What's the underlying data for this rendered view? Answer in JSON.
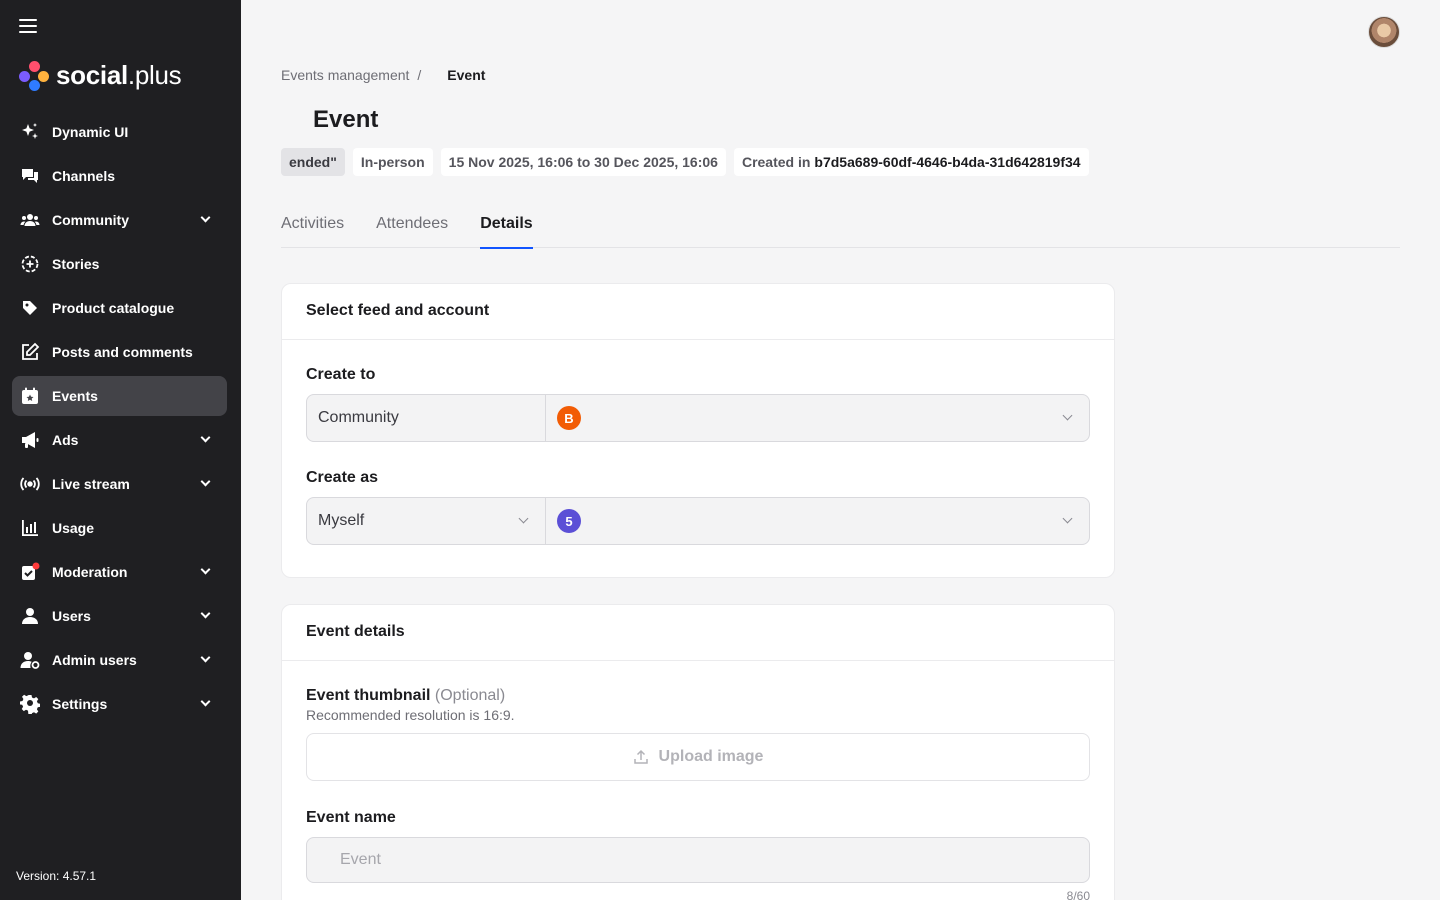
{
  "brand": {
    "name_bold": "social",
    "name_light": ".plus"
  },
  "sidebar": {
    "items": [
      {
        "label": "Dynamic UI",
        "icon": "sparkles-icon",
        "expandable": false,
        "active": false
      },
      {
        "label": "Channels",
        "icon": "chat-bubbles-icon",
        "expandable": false,
        "active": false
      },
      {
        "label": "Community",
        "icon": "people-icon",
        "expandable": true,
        "active": false
      },
      {
        "label": "Stories",
        "icon": "stories-icon",
        "expandable": false,
        "active": false
      },
      {
        "label": "Product catalogue",
        "icon": "tag-icon",
        "expandable": false,
        "active": false
      },
      {
        "label": "Posts and comments",
        "icon": "edit-icon",
        "expandable": false,
        "active": false
      },
      {
        "label": "Events",
        "icon": "calendar-icon",
        "expandable": false,
        "active": true
      },
      {
        "label": "Ads",
        "icon": "megaphone-icon",
        "expandable": true,
        "active": false
      },
      {
        "label": "Live stream",
        "icon": "broadcast-icon",
        "expandable": true,
        "active": false
      },
      {
        "label": "Usage",
        "icon": "bar-chart-icon",
        "expandable": false,
        "active": false
      },
      {
        "label": "Moderation",
        "icon": "moderation-icon",
        "expandable": true,
        "active": false
      },
      {
        "label": "Users",
        "icon": "user-icon",
        "expandable": true,
        "active": false
      },
      {
        "label": "Admin users",
        "icon": "admin-user-icon",
        "expandable": true,
        "active": false
      },
      {
        "label": "Settings",
        "icon": "gear-icon",
        "expandable": true,
        "active": false
      }
    ],
    "version": "Version: 4.57.1"
  },
  "breadcrumb": {
    "parent": "Events management",
    "separator": "/",
    "current": "Event"
  },
  "page": {
    "title": "Event",
    "badges": {
      "status": "ended\"",
      "type": "In-person",
      "date_range": "15 Nov 2025, 16:06 to 30 Dec 2025, 16:06",
      "created_prefix": "Created in",
      "created_id": "b7d5a689-60df-4646-b4da-31d642819f34"
    },
    "tabs": [
      "Activities",
      "Attendees",
      "Details"
    ],
    "active_tab": "Details"
  },
  "feed_card": {
    "title": "Select feed and account",
    "create_to": {
      "label": "Create to",
      "type_value": "Community",
      "avatar_letter": "B",
      "avatar_color": "#f25c05"
    },
    "create_as": {
      "label": "Create as",
      "type_value": "Myself",
      "avatar_letter": "5",
      "avatar_color": "#5b4fd6"
    }
  },
  "details_card": {
    "title": "Event details",
    "thumbnail": {
      "label": "Event thumbnail",
      "optional": "(Optional)",
      "hint": "Recommended resolution is 16:9.",
      "upload_label": "Upload image"
    },
    "name": {
      "label": "Event name",
      "value": "Event",
      "counter": "8/60"
    }
  },
  "colors": {
    "accent": "#1154ff",
    "sidebar_bg": "#1f1f22",
    "active_item_bg": "#434348"
  }
}
